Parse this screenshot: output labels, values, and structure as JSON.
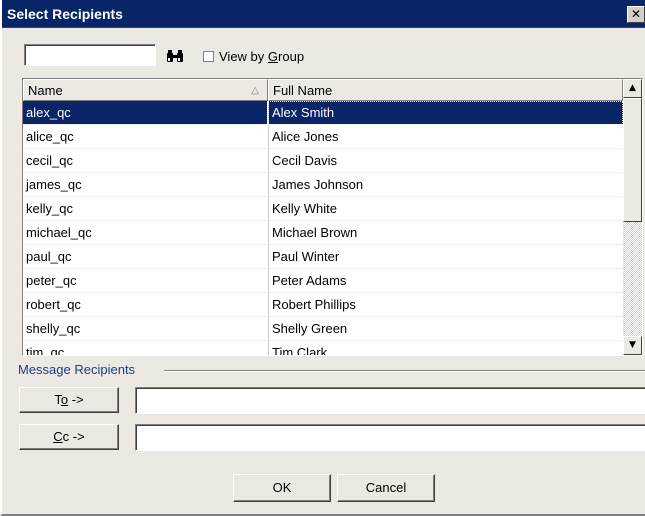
{
  "window": {
    "title": "Select Recipients",
    "close_glyph": "✕"
  },
  "search": {
    "value": "",
    "placeholder": ""
  },
  "view_by_group": {
    "label_prefix": "View by ",
    "label_accel": "G",
    "label_suffix": "roup",
    "checked": false
  },
  "columns": {
    "name": "Name",
    "full_name": "Full Name",
    "sort_glyph": "△"
  },
  "users": [
    {
      "name": "alex_qc",
      "full_name": "Alex Smith",
      "selected": true
    },
    {
      "name": "alice_qc",
      "full_name": "Alice Jones"
    },
    {
      "name": "cecil_qc",
      "full_name": "Cecil Davis"
    },
    {
      "name": "james_qc",
      "full_name": "James Johnson"
    },
    {
      "name": "kelly_qc",
      "full_name": "Kelly White"
    },
    {
      "name": "michael_qc",
      "full_name": "Michael Brown"
    },
    {
      "name": "paul_qc",
      "full_name": "Paul Winter"
    },
    {
      "name": "peter_qc",
      "full_name": "Peter Adams"
    },
    {
      "name": "robert_qc",
      "full_name": "Robert Phillips"
    },
    {
      "name": "shelly_qc",
      "full_name": "Shelly Green"
    },
    {
      "name": "tim_qc",
      "full_name": "Tim Clark"
    }
  ],
  "message_recipients": {
    "label": "Message Recipients",
    "to": {
      "pre": "T",
      "accel": "o",
      "post": " ->",
      "value": ""
    },
    "cc": {
      "pre": "",
      "accel": "C",
      "post": "c ->",
      "value": ""
    }
  },
  "buttons": {
    "ok": "OK",
    "cancel": "Cancel"
  },
  "colors": {
    "title_bar": "#0a2468",
    "selection": "#0a2468",
    "dialog_bg": "#ece9e2"
  }
}
